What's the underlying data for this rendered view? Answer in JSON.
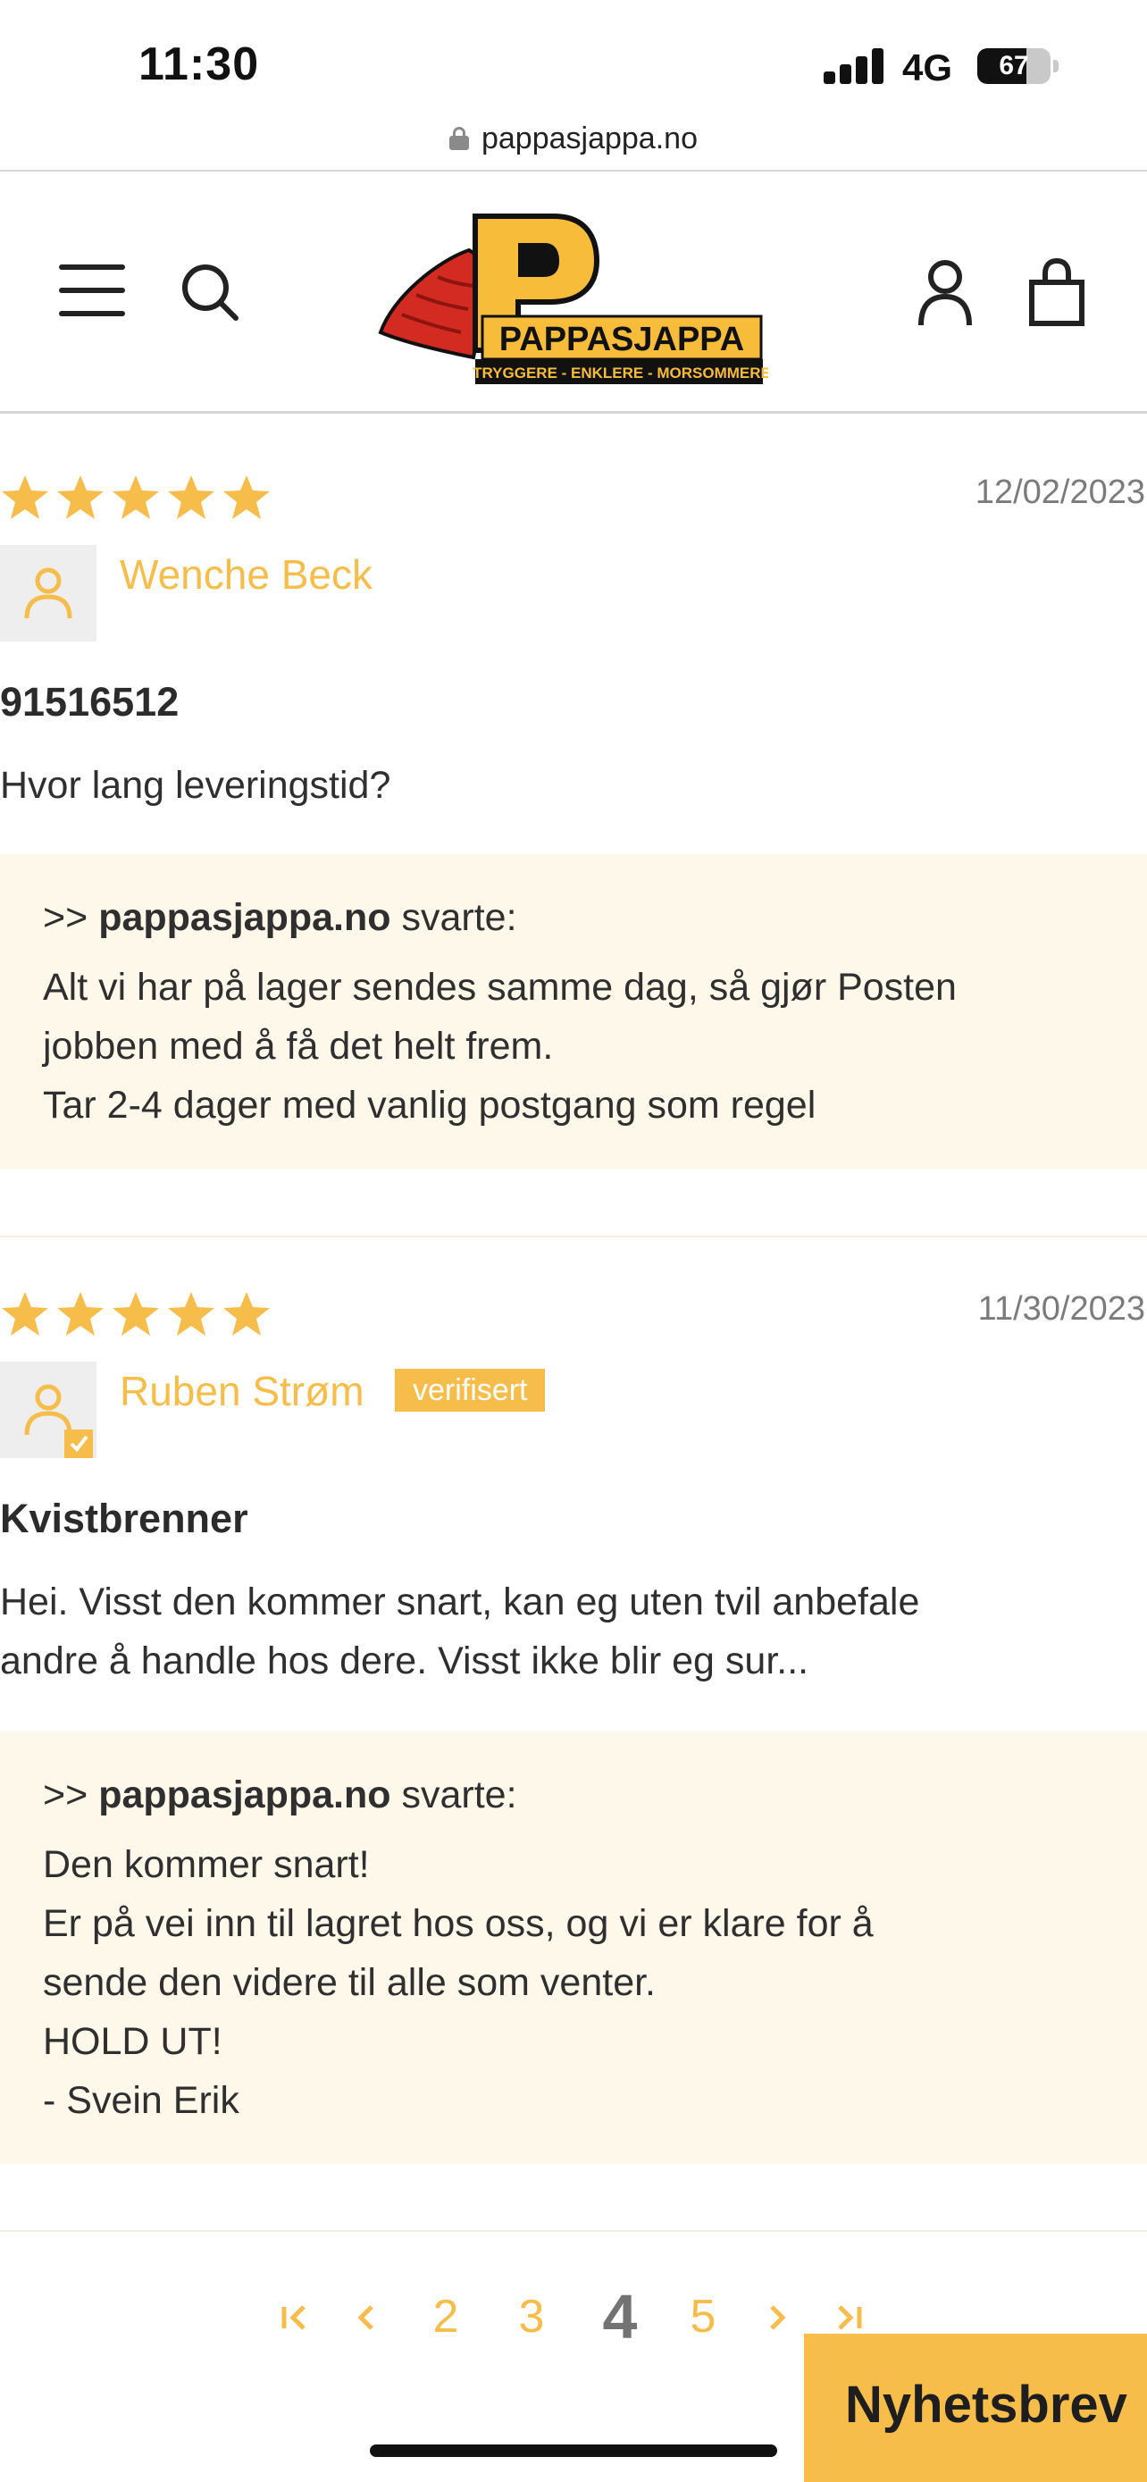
{
  "status_bar": {
    "time": "11:30",
    "network": "4G",
    "battery": "67",
    "battery_level": 0.67
  },
  "browser": {
    "url": "pappasjappa.no"
  },
  "header": {
    "logo_name": "PAPPASJAPPA",
    "logo_tagline": "TRYGGERE - ENKLERE - MORSOMMERE",
    "icons": [
      "menu-icon",
      "search-icon",
      "account-icon",
      "cart-icon"
    ]
  },
  "colors": {
    "accent": "#f6bd4a",
    "reply_bg": "#fef8ea",
    "text": "#2b2b2b",
    "muted": "#7b7b7b"
  },
  "reviews": [
    {
      "rating": 5,
      "date": "12/02/2023",
      "author": "Wenche Beck",
      "verified": false,
      "title": "91516512",
      "body": "Hvor lang leveringstid?",
      "reply": {
        "prefix": ">>",
        "author": "pappasjappa.no",
        "suffix": "svarte:",
        "lines": [
          "Alt vi har på lager sendes samme dag, så gjør Posten",
          "jobben med å få det helt frem.",
          "Tar 2-4 dager med vanlig postgang som regel"
        ]
      }
    },
    {
      "rating": 5,
      "date": "11/30/2023",
      "author": "Ruben Strøm",
      "verified": true,
      "verified_label": "verifisert",
      "title": "Kvistbrenner",
      "body_lines": [
        "Hei. Visst den kommer snart, kan eg uten tvil anbefale",
        "andre å handle hos dere. Visst ikke blir eg sur..."
      ],
      "reply": {
        "prefix": ">>",
        "author": "pappasjappa.no",
        "suffix": "svarte:",
        "lines": [
          "Den kommer snart!",
          "Er på vei inn til lagret hos oss, og vi er klare for å",
          "sende den videre til alle som venter.",
          "HOLD UT!",
          "- Svein Erik"
        ]
      }
    }
  ],
  "pagination": {
    "first": "first-page-icon",
    "prev": "prev-page-icon",
    "pages": [
      "2",
      "3",
      "4",
      "5"
    ],
    "current": "4",
    "next": "next-page-icon",
    "last": "last-page-icon"
  },
  "newsletter": {
    "label": "Nyhetsbrev"
  }
}
